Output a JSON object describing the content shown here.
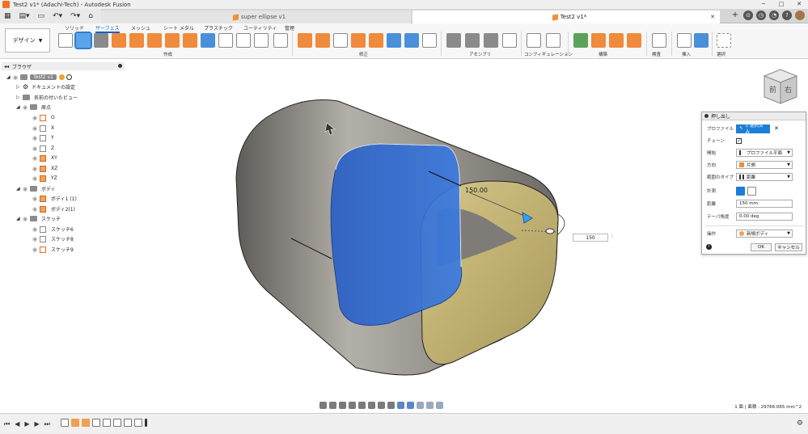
{
  "window": {
    "title": "Test2 v1* (Adachi-Tech) - Autodesk Fusion",
    "controls": [
      "─",
      "□",
      "✕"
    ]
  },
  "tabs": {
    "super": "super ellipse v1",
    "test2": "Test2 v1*",
    "close": "✕"
  },
  "ribbon": {
    "workspace": "デザイン",
    "tabs": [
      "ソリッド",
      "サーフェス",
      "メッシュ",
      "シート メタル",
      "プラスチック",
      "ユーティリティ",
      "管理"
    ],
    "groups": [
      "作成",
      "修正",
      "アセンブリ",
      "コンフィギュレーション",
      "構築",
      "検査",
      "挿入",
      "選択"
    ]
  },
  "browser": {
    "title": "ブラウザ",
    "root": "Test2 v1",
    "items": {
      "doc_settings": "ドキュメントの設定",
      "named_views": "名前の付いたビュー",
      "origin": "原点",
      "o": "O",
      "x": "X",
      "y": "Y",
      "z": "Z",
      "xy": "XY",
      "xz": "XZ",
      "yz": "YZ",
      "bodies": "ボディ",
      "body1": "ボディ1 (1)",
      "body2": "ボディ2(1)",
      "sketches": "スケッチ",
      "sketch6": "スケッチ6",
      "sketch8": "スケッチ8",
      "sketch9": "スケッチ9"
    }
  },
  "viewport": {
    "dimension_label": "150.00",
    "dimension_input": "150",
    "viewcube_front": "前",
    "viewcube_right": "右"
  },
  "dialog": {
    "title": "押し出し",
    "profile_label": "プロファイル",
    "profile_value": "1 選択済み",
    "chain_label": "チェーン",
    "start_label": "開始",
    "start_value": "プロファイル平面",
    "direction_label": "方向",
    "direction_value": "片側",
    "extent_label": "範囲のタイプ",
    "extent_value": "距離",
    "measure_label": "計測",
    "distance_label": "距離",
    "distance_value": "150 mm",
    "taper_label": "テーパ角度",
    "taper_value": "0.00 deg",
    "operation_label": "操作",
    "operation_value": "新規ボディ",
    "ok": "OK",
    "cancel": "キャンセル"
  },
  "status": {
    "text": "1 面 | 面積 : 29766.065 mm^2"
  },
  "colors": {
    "selection": "#1c7ed6",
    "accent": "#f37021",
    "surface_gray": "#8a8884",
    "surface_tan": "#c6b574",
    "surface_blue": "#2f6fd6"
  }
}
